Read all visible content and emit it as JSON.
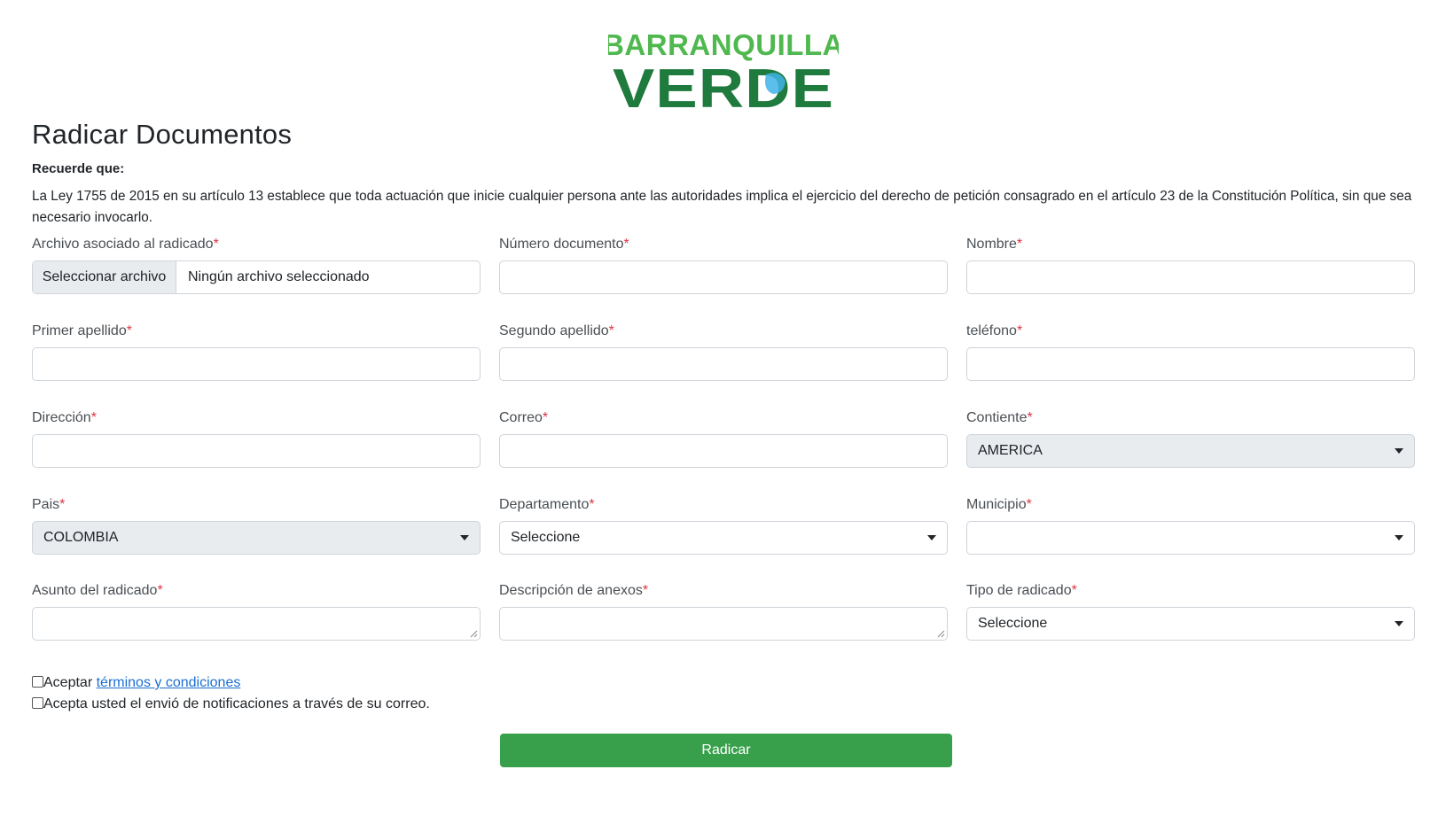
{
  "logo": {
    "line1": "BARRANQUILLA",
    "line2": "VERDE"
  },
  "page_title": "Radicar Documentos",
  "notice": {
    "heading": "Recuerde que:",
    "body": "La Ley 1755 de 2015 en su artículo 13 establece que toda actuación que inicie cualquier persona ante las autoridades implica el ejercicio del derecho de petición consagrado en el artículo 23 de la Constitución Política, sin que sea necesario invocarlo."
  },
  "required_mark": "*",
  "form": {
    "archivo": {
      "label": "Archivo asociado al radicado",
      "button": "Seleccionar archivo",
      "status": "Ningún archivo seleccionado"
    },
    "numero_documento": {
      "label": "Número documento",
      "value": ""
    },
    "nombre": {
      "label": "Nombre",
      "value": ""
    },
    "primer_apellido": {
      "label": "Primer apellido",
      "value": ""
    },
    "segundo_apellido": {
      "label": "Segundo apellido",
      "value": ""
    },
    "telefono": {
      "label": "teléfono",
      "value": ""
    },
    "direccion": {
      "label": "Dirección",
      "value": ""
    },
    "correo": {
      "label": "Correo",
      "value": ""
    },
    "continente": {
      "label": "Contiente",
      "selected": "AMERICA"
    },
    "pais": {
      "label": "Pais",
      "selected": "COLOMBIA"
    },
    "departamento": {
      "label": "Departamento",
      "selected": "Seleccione"
    },
    "municipio": {
      "label": "Municipio",
      "selected": ""
    },
    "asunto": {
      "label": "Asunto del radicado",
      "value": ""
    },
    "descripcion_anexos": {
      "label": "Descripción de anexos",
      "value": ""
    },
    "tipo_radicado": {
      "label": "Tipo de radicado",
      "selected": "Seleccione"
    }
  },
  "checkboxes": {
    "terms_prefix": "Aceptar",
    "terms_link": "términos y condiciones",
    "notifications": "Acepta usted el envió de notificaciones a través de su correo."
  },
  "submit_label": "Radicar",
  "colors": {
    "brand_green": "#38a04b",
    "logo_dark_green": "#1f7a3d",
    "logo_light_green": "#4fb84e",
    "required_red": "#dc3545",
    "link_blue": "#1a6fd1",
    "drop_blue": "#3fb4e8"
  }
}
